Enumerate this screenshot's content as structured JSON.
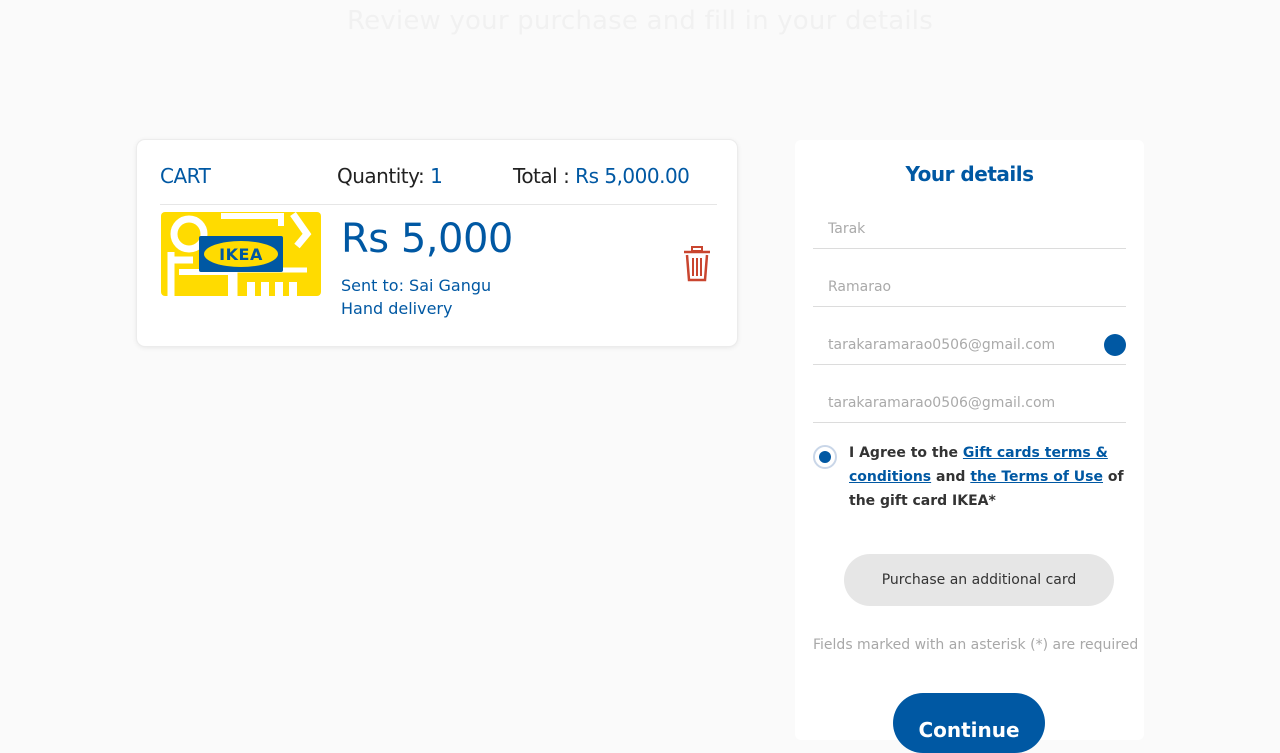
{
  "header": {
    "subtitle": "Review your purchase and fill in your details"
  },
  "cart": {
    "title": "CART",
    "quantity_label": "Quantity:",
    "quantity_value": "1",
    "total_label": "Total :",
    "total_value": "Rs 5,000.00",
    "item": {
      "card_brand": "IKEA",
      "amount": "Rs 5,000",
      "sent_to": "Sent to: Sai Gangu",
      "delivery": "Hand delivery",
      "delete_icon": "trash-icon"
    }
  },
  "details": {
    "title": "Your details",
    "first_name_placeholder": "Tarak",
    "last_name_placeholder": "Ramarao",
    "email_placeholder": "tarakaramarao0506@gmail.com",
    "email_confirm_placeholder": "tarakaramarao0506@gmail.com",
    "agree": {
      "prefix": "I Agree to the ",
      "link1": "Gift cards terms & conditions",
      "middle": " and ",
      "link2": "the Terms of Use",
      "suffix": " of the gift card IKEA*"
    },
    "add_card_label": "Purchase an additional card",
    "required_note": "Fields marked with an asterisk (*) are required",
    "continue_label": "Continue"
  },
  "colors": {
    "accent": "#0058a3",
    "ikea_yellow": "#ffdb00",
    "danger": "#c9452f"
  }
}
